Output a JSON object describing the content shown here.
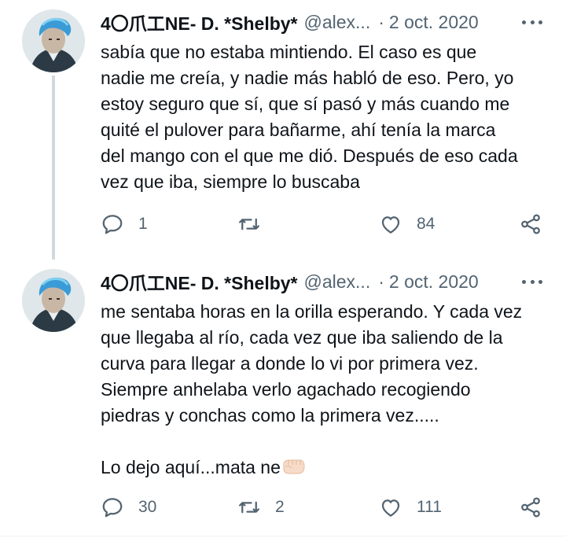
{
  "colors": {
    "text": "#0f1419",
    "muted": "#536471",
    "thread_line": "#cfd9de",
    "background": "#ffffff"
  },
  "tweets": [
    {
      "author_name": "4〇爪工NE- D. *Shelby*",
      "handle": "@alex...",
      "dot": "·",
      "date": "2 oct. 2020",
      "text": "sabía que no estaba mintiendo. El caso es que\nnadie me creía, y nadie más habló de eso. Pero, yo\nestoy seguro que sí, que sí pasó y más cuando me\nquité el pulover para bañarme, ahí tenía la marca\ndel mango con el que me dió. Después de eso cada\nvez que iba, siempre lo buscaba",
      "replies": "1",
      "retweets": "",
      "likes": "84",
      "icons": [
        "reply-icon",
        "retweet-icon",
        "like-icon",
        "share-icon",
        "more-icon"
      ]
    },
    {
      "author_name": "4〇爪工NE- D. *Shelby*",
      "handle": "@alex...",
      "dot": "·",
      "date": "2 oct. 2020",
      "text": "me sentaba horas en la orilla esperando. Y cada vez\nque llegaba al río, cada vez que iba saliendo de la\ncurva para llegar a donde lo vi por primera vez.\nSiempre anhelaba verlo agachado recogiendo\npiedras y conchas como la primera vez.....\n\n",
      "text_last_line": "Lo dejo aquí...mata ne",
      "emoji": "left-facing-fist-emoji",
      "replies": "30",
      "retweets": "2",
      "likes": "111",
      "icons": [
        "reply-icon",
        "retweet-icon",
        "like-icon",
        "share-icon",
        "more-icon"
      ]
    }
  ]
}
